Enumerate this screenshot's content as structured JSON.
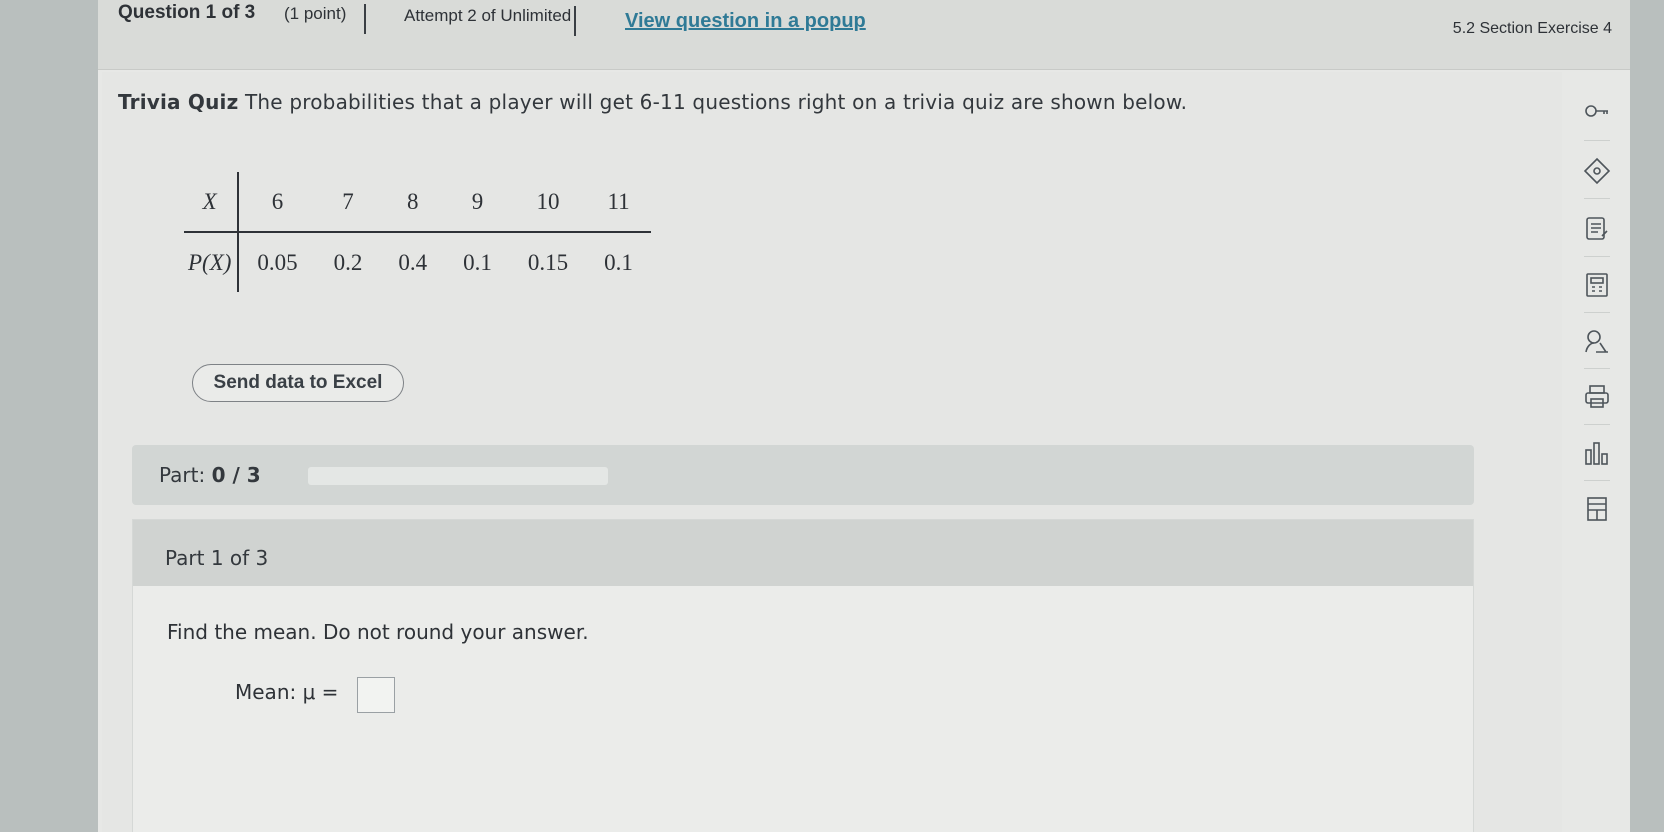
{
  "header": {
    "question_label": "Question 1 of 3",
    "points": "(1 point)",
    "attempt": "Attempt 2 of Unlimited",
    "popup_link": "View question in a popup",
    "section": "5.2 Section Exercise 4"
  },
  "question": {
    "title": "Trivia Quiz",
    "text": " The probabilities that a player will get 6-11 questions right on a trivia quiz are shown below."
  },
  "distribution": {
    "x_label": "X",
    "p_label": "P(X)",
    "x_values": [
      "6",
      "7",
      "8",
      "9",
      "10",
      "11"
    ],
    "p_values": [
      "0.05",
      "0.2",
      "0.4",
      "0.1",
      "0.15",
      "0.1"
    ]
  },
  "excel_button": "Send data to Excel",
  "progress": {
    "label": "Part: ",
    "value": "0 / 3",
    "fraction": 0
  },
  "part1": {
    "header": "Part 1 of 3",
    "instruction": "Find the mean. Do not round your answer.",
    "answer_label": "Mean: μ =",
    "answer_value": ""
  },
  "tools": [
    {
      "icon": "key-icon"
    },
    {
      "icon": "tag-icon"
    },
    {
      "icon": "notes-icon"
    },
    {
      "icon": "calculator-icon"
    },
    {
      "icon": "tutor-icon"
    },
    {
      "icon": "print-icon"
    },
    {
      "icon": "chart-icon"
    },
    {
      "icon": "table-icon"
    }
  ]
}
